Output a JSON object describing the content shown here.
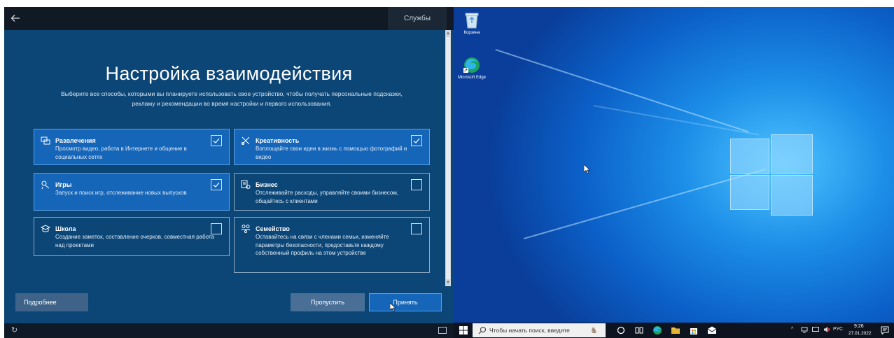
{
  "oobe": {
    "services_label": "Службы",
    "title": "Настройка взаимодействия",
    "subtitle_line1": "Выберите все способы, которыми вы планируете использовать свое устройство, чтобы получать персональные подсказки,",
    "subtitle_line2": "рекламу и рекомендации во время настройки и первого использования.",
    "cards": [
      {
        "title": "Развлечения",
        "desc": "Просмотр видео, работа в Интернете и общение в социальных сетях",
        "selected": true,
        "icon": "entertainment-icon"
      },
      {
        "title": "Креативность",
        "desc": "Воплощайте свои идеи в жизнь с помощью фотографий и видео",
        "selected": true,
        "icon": "creativity-icon"
      },
      {
        "title": "Игры",
        "desc": "Запуск и поиск игр, отслеживание новых выпусков",
        "selected": true,
        "icon": "gaming-icon"
      },
      {
        "title": "Бизнес",
        "desc": "Отслеживайте расходы, управляйте своими бизнесом, общайтесь с клиентами",
        "selected": false,
        "icon": "business-icon"
      },
      {
        "title": "Школа",
        "desc": "Создание заметок, составление очерков, совместная работа над проектами",
        "selected": false,
        "icon": "school-icon"
      },
      {
        "title": "Семейство",
        "desc": "Оставайтесь на связи с членами семьи, изменяйте параметры безопасности, предоставьте каждому собственный профиль на этом устройстве",
        "selected": false,
        "icon": "family-icon"
      }
    ],
    "buttons": {
      "more": "Подробнее",
      "skip": "Пропустить",
      "accept": "Принять"
    }
  },
  "desktop": {
    "icons": [
      {
        "label": "Корзина",
        "icon": "recycle-bin-icon"
      },
      {
        "label": "Microsoft Edge",
        "icon": "edge-icon"
      }
    ]
  },
  "taskbar": {
    "search_placeholder": "Чтобы начать поиск, введите",
    "language": "РУС",
    "time": "9:26",
    "date": "27.01.2022"
  },
  "colors": {
    "oobe_bg": "#0b4677",
    "card_selected": "#1565b8",
    "desktop_accent": "#1c8ee8",
    "taskbar_bg": "#0d1420"
  }
}
